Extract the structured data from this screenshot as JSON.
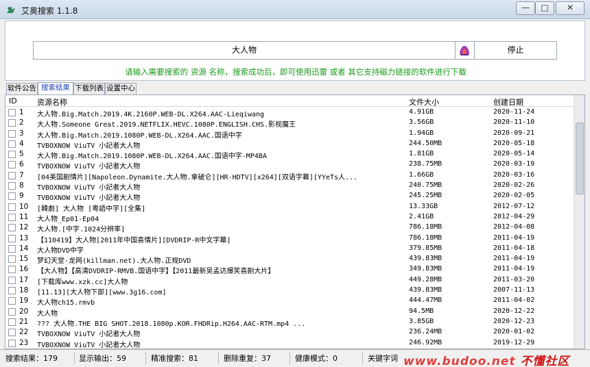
{
  "window": {
    "title": "艾奥搜索 1.1.8",
    "min_label": "—",
    "max_label": "□",
    "close_label": "✕"
  },
  "search": {
    "value": "大人物",
    "stop_label": "停止",
    "hint": "请输入需要搜索的 资源 名称，搜索成功后，即可使用迅雷 或者 其它支持磁力链接的软件进行下载"
  },
  "tabs": [
    "软件公告",
    "搜索结果",
    "下载列表",
    "设置中心"
  ],
  "columns": {
    "id": "ID",
    "name": "资源名称",
    "size": "文件大小",
    "date": "创建日期"
  },
  "rows": [
    {
      "id": "1",
      "name": "大人物.Big.Match.2019.4K.2160P.WEB-DL.X264.AAC-Lieqiwang",
      "size": "4.91GB",
      "date": "2020-11-24"
    },
    {
      "id": "2",
      "name": "大人物.Someone Great.2019.NETFLIX.HEVC.1080P.ENGLISH.CHS.影视魔王",
      "size": "3.56GB",
      "date": "2020-11-10"
    },
    {
      "id": "3",
      "name": "大人物.Big.Match.2019.1080P.WEB-DL.X264.AAC.国语中字",
      "size": "1.94GB",
      "date": "2020-09-21"
    },
    {
      "id": "4",
      "name": "TVBOXNOW ViuTV 小記者大人物",
      "size": "244.50MB",
      "date": "2020-05-18"
    },
    {
      "id": "5",
      "name": "大人物.Big.Match.2019.1080P.WEB-DL.X264.AAC.国语中字-MP4BA",
      "size": "1.81GB",
      "date": "2020-05-14"
    },
    {
      "id": "6",
      "name": "TVBOXNOW ViuTV 小記者大人物",
      "size": "238.75MB",
      "date": "2020-03-19"
    },
    {
      "id": "7",
      "name": "[04美国剧情片][Napoleon.Dynamite.大人物.拿破仑][HR-HDTV][x264][双语字幕][YYeTs人...",
      "size": "1.66GB",
      "date": "2020-03-16"
    },
    {
      "id": "8",
      "name": "TVBOXNOW ViuTV 小記者大人物",
      "size": "240.75MB",
      "date": "2020-02-26"
    },
    {
      "id": "9",
      "name": "TVBOXNOW ViuTV 小記者大人物",
      "size": "245.25MB",
      "date": "2020-02-05"
    },
    {
      "id": "10",
      "name": "[韓劇] 大人物 [粵語中字][全集]",
      "size": "13.33GB",
      "date": "2012-07-12"
    },
    {
      "id": "11",
      "name": "大人物_Ep01-Ep04",
      "size": "2.41GB",
      "date": "2012-04-29"
    },
    {
      "id": "12",
      "name": "大人物.[中字.1024分辨率]",
      "size": "786.18MB",
      "date": "2012-04-08"
    },
    {
      "id": "13",
      "name": "【110419】大人物[2011年中国喜情片][DVDRIP-R中文字幕]",
      "size": "786.18MB",
      "date": "2011-04-19"
    },
    {
      "id": "14",
      "name": "大人物DVD中字",
      "size": "379.85MB",
      "date": "2011-04-18"
    },
    {
      "id": "15",
      "name": "梦幻天堂·龙网(killman.net).大人物.正规DVD",
      "size": "439.83MB",
      "date": "2011-04-19"
    },
    {
      "id": "16",
      "name": "【大人物】【高清DVDRIP-RMVB.国语中字】【2011最新吴孟达爆笑喜剧大片】",
      "size": "349.83MB",
      "date": "2011-04-19"
    },
    {
      "id": "17",
      "name": "[下载库www.xzk.cc]大人物",
      "size": "449.28MB",
      "date": "2011-03-20"
    },
    {
      "id": "18",
      "name": "[11.13][大人物下部][www.3g16.com]",
      "size": "439.83MB",
      "date": "2007-11-13"
    },
    {
      "id": "19",
      "name": "大人物ch15.rmvb",
      "size": "444.47MB",
      "date": "2011-04-02"
    },
    {
      "id": "20",
      "name": "大人物",
      "size": "94.5MB",
      "date": "2020-12-22"
    },
    {
      "id": "21",
      "name": "??? 大人物.THE BIG SHOT.2018.1080p.KOR.FHDRip.H264.AAC-RTM.mp4           ...",
      "size": "3.85GB",
      "date": "2020-12-23"
    },
    {
      "id": "22",
      "name": "TVBOXNOW ViuTV 小記者大人物",
      "size": "236.24MB",
      "date": "2020-01-02"
    },
    {
      "id": "23",
      "name": "TVBOXNOW ViuTV 小記者大人物",
      "size": "246.92MB",
      "date": "2019-12-29"
    }
  ],
  "status": {
    "results": "搜索结果：179",
    "shown": "显示输出：59",
    "exact": "精准搜索：81",
    "dedup": "删除重复：37",
    "health": "健康模式：0",
    "keyword": "关键字词"
  },
  "watermark": {
    "latin": "www.budoo.net",
    "cn": "不懂社区"
  }
}
